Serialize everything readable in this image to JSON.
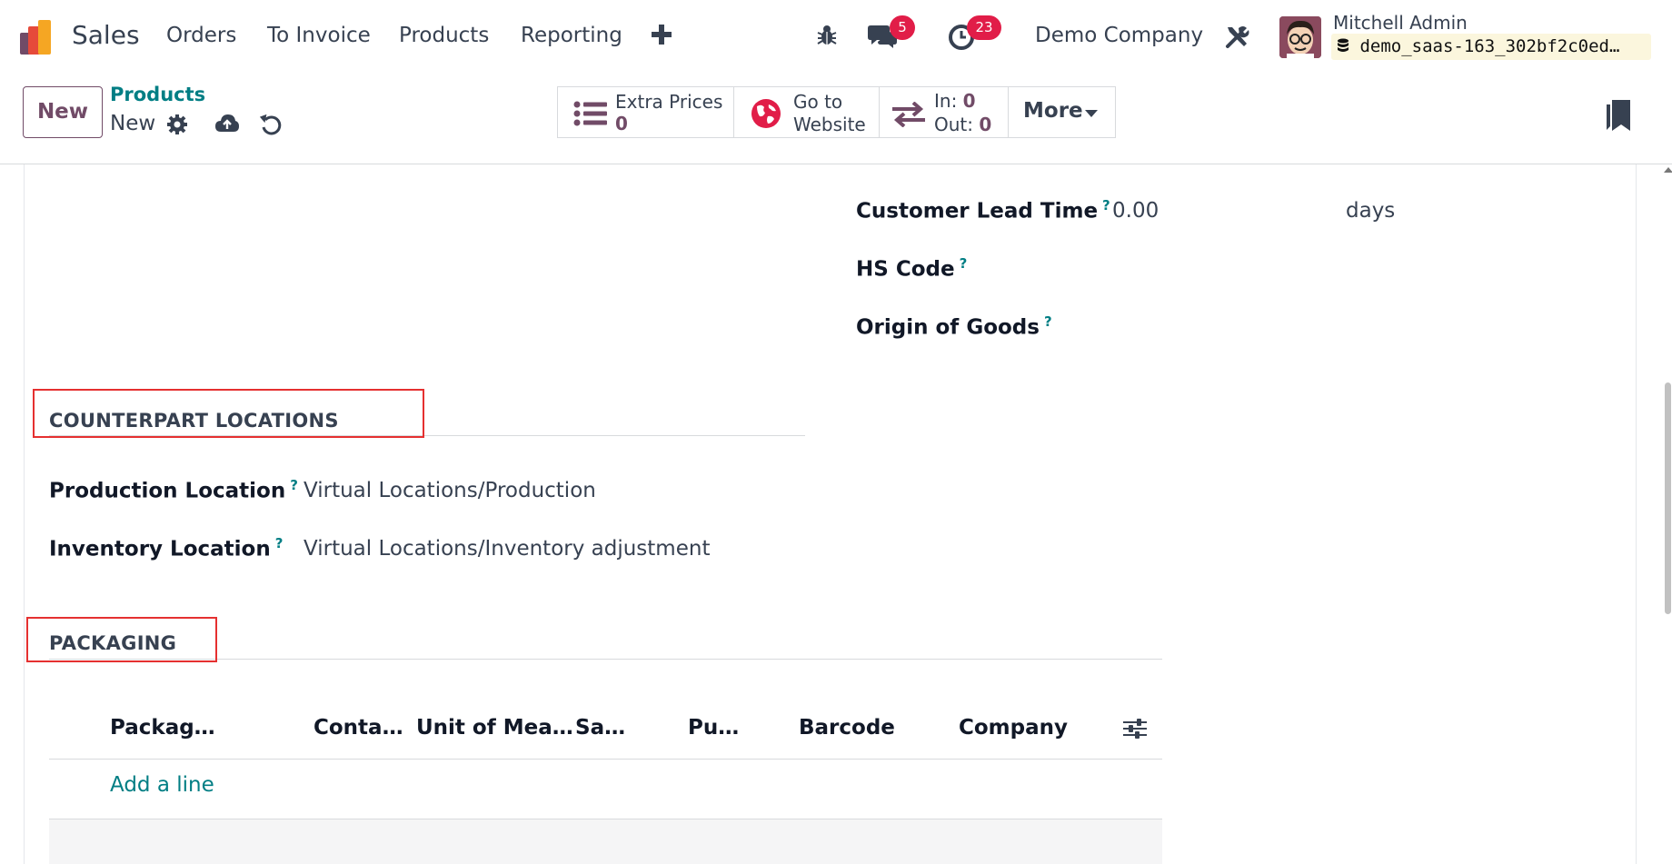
{
  "navbar": {
    "app_name": "Sales",
    "menu": [
      "Orders",
      "To Invoice",
      "Products",
      "Reporting"
    ],
    "plus_icon": "plus-icon",
    "messages_badge": "5",
    "activities_badge": "23",
    "company": "Demo Company",
    "user_name": "Mitchell Admin",
    "database": "demo_saas-163_302bf2c0ed…"
  },
  "control": {
    "new_label": "New",
    "breadcrumb_parent": "Products",
    "breadcrumb_current": "New",
    "extra_prices_label": "Extra Prices",
    "extra_prices_value": "0",
    "go_to_label_1": "Go to",
    "go_to_label_2": "Website",
    "in_label": "In:",
    "in_value": "0",
    "out_label": "Out:",
    "out_value": "0",
    "more_label": "More"
  },
  "form": {
    "customer_lead_time_label": "Customer Lead Time",
    "customer_lead_time_value": "0.00",
    "customer_lead_time_unit": "days",
    "hs_code_label": "HS Code",
    "origin_label": "Origin of Goods",
    "counterpart_title": "COUNTERPART LOCATIONS",
    "production_location_label": "Production Location",
    "production_location_value": "Virtual Locations/Production",
    "inventory_location_label": "Inventory Location",
    "inventory_location_value": "Virtual Locations/Inventory adjustment",
    "packaging_title": "PACKAGING",
    "help_mark": "?"
  },
  "packaging_table": {
    "columns": [
      "Packag…",
      "Conta…",
      "Unit of Mea…",
      "Sa…",
      "Pu…",
      "Barcode",
      "Company"
    ],
    "add_line": "Add a line"
  },
  "colors": {
    "brand": "#714b67",
    "link": "#017e84",
    "badge": "#e11d48",
    "highlight": "#e53030"
  }
}
